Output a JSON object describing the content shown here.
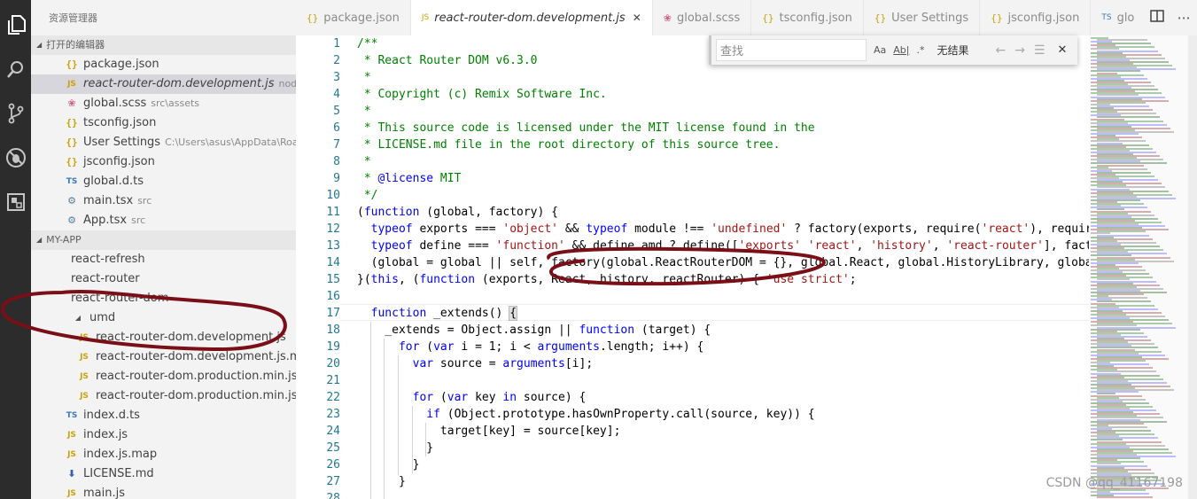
{
  "activity_bar": {
    "icons": [
      "explorer-icon",
      "search-icon",
      "source-control-icon",
      "debug-icon",
      "extensions-icon"
    ]
  },
  "sidebar": {
    "title": "资源管理器",
    "open_editors": {
      "label": "打开的编辑器",
      "items": [
        {
          "icon": "{}",
          "name": "package.json",
          "desc": "",
          "kind": "json",
          "active": false
        },
        {
          "icon": "JS",
          "name": "react-router-dom.development.js",
          "desc": "node_mo...",
          "kind": "js",
          "active": true
        },
        {
          "icon": "scss",
          "name": "global.scss",
          "desc": "src\\assets",
          "kind": "scss",
          "active": false
        },
        {
          "icon": "{}",
          "name": "tsconfig.json",
          "desc": "",
          "kind": "json",
          "active": false
        },
        {
          "icon": "{}",
          "name": "User Settings",
          "desc": "C:\\Users\\asus\\AppData\\Roam...",
          "kind": "json",
          "active": false
        },
        {
          "icon": "{}",
          "name": "jsconfig.json",
          "desc": "",
          "kind": "json",
          "active": false
        },
        {
          "icon": "TS",
          "name": "global.d.ts",
          "desc": "",
          "kind": "ts",
          "active": false
        },
        {
          "icon": "gear",
          "name": "main.tsx",
          "desc": "src",
          "kind": "gear",
          "active": false
        },
        {
          "icon": "gear",
          "name": "App.tsx",
          "desc": "src",
          "kind": "gear",
          "active": false
        }
      ]
    },
    "project": {
      "label": "MY-APP",
      "items": [
        {
          "icon": "",
          "name": "react-refresh",
          "indent": 45,
          "kind": "folder"
        },
        {
          "icon": "",
          "name": "react-router",
          "indent": 45,
          "kind": "folder"
        },
        {
          "icon": "",
          "name": "react-router-dom",
          "indent": 45,
          "kind": "folder"
        },
        {
          "icon": "▴",
          "name": "umd",
          "indent": 45,
          "kind": "folder-open"
        },
        {
          "icon": "JS",
          "name": "react-router-dom.development.js",
          "indent": 52,
          "kind": "js"
        },
        {
          "icon": "JS",
          "name": "react-router-dom.development.js.map",
          "indent": 52,
          "kind": "js"
        },
        {
          "icon": "JS",
          "name": "react-router-dom.production.min.js",
          "indent": 52,
          "kind": "js"
        },
        {
          "icon": "JS",
          "name": "react-router-dom.production.min.js.m...",
          "indent": 52,
          "kind": "js"
        },
        {
          "icon": "TS",
          "name": "index.d.ts",
          "indent": 38,
          "kind": "ts"
        },
        {
          "icon": "JS",
          "name": "index.js",
          "indent": 38,
          "kind": "js"
        },
        {
          "icon": "JS",
          "name": "index.js.map",
          "indent": 38,
          "kind": "js"
        },
        {
          "icon": "⬇",
          "name": "LICENSE.md",
          "indent": 38,
          "kind": "dl"
        },
        {
          "icon": "JS",
          "name": "main.js",
          "indent": 38,
          "kind": "js"
        }
      ]
    }
  },
  "tabs": [
    {
      "icon": "{}",
      "name": "package.json",
      "kind": "json",
      "active": false
    },
    {
      "icon": "JS",
      "name": "react-router-dom.development.js",
      "kind": "js",
      "active": true,
      "close": "✕"
    },
    {
      "icon": "scss",
      "name": "global.scss",
      "kind": "scss",
      "active": false
    },
    {
      "icon": "{}",
      "name": "tsconfig.json",
      "kind": "json",
      "active": false
    },
    {
      "icon": "{}",
      "name": "User Settings",
      "kind": "json",
      "active": false
    },
    {
      "icon": "{}",
      "name": "jsconfig.json",
      "kind": "json",
      "active": false
    },
    {
      "icon": "TS",
      "name": "glo",
      "kind": "ts",
      "active": false
    }
  ],
  "tab_actions": [
    "split-editor-icon",
    "more-icon"
  ],
  "find_widget": {
    "placeholder": "查找",
    "match_case": "Aa",
    "whole_word": "Ab|",
    "regex": ".*",
    "result": "无结果",
    "prev": "←",
    "next": "→",
    "selection": "☰",
    "close": "✕"
  },
  "editor": {
    "line_numbers": [
      1,
      2,
      3,
      4,
      5,
      6,
      7,
      8,
      9,
      10,
      11,
      12,
      13,
      14,
      15,
      16,
      17,
      18,
      19,
      20,
      21,
      22,
      23,
      24,
      25,
      26,
      27,
      28
    ],
    "lines": [
      [
        [
          "c-com",
          "/**"
        ]
      ],
      [
        [
          "c-com",
          " * React Router DOM v6.3.0"
        ]
      ],
      [
        [
          "c-com",
          " *"
        ]
      ],
      [
        [
          "c-com",
          " * Copyright (c) Remix Software Inc."
        ]
      ],
      [
        [
          "c-com",
          " *"
        ]
      ],
      [
        [
          "c-com",
          " * This source code is licensed under the MIT license found in the"
        ]
      ],
      [
        [
          "c-com",
          " * LICENSE.md file in the root directory of this source tree."
        ]
      ],
      [
        [
          "c-com",
          " *"
        ]
      ],
      [
        [
          "c-com",
          " * "
        ],
        [
          "c-ann",
          "@license"
        ],
        [
          "c-com",
          " MIT"
        ]
      ],
      [
        [
          "c-com",
          " */"
        ]
      ],
      [
        [
          "",
          "("
        ],
        [
          "c-kw",
          "function"
        ],
        [
          "",
          " (global, factory) {"
        ]
      ],
      [
        [
          "",
          "  "
        ],
        [
          "c-kw",
          "typeof"
        ],
        [
          "",
          " exports === "
        ],
        [
          "c-str",
          "'object'"
        ],
        [
          "",
          " && "
        ],
        [
          "c-kw",
          "typeof"
        ],
        [
          "",
          " module !== "
        ],
        [
          "c-str",
          "'undefined'"
        ],
        [
          "",
          " ? factory(exports, require("
        ],
        [
          "c-str",
          "'react'"
        ],
        [
          "",
          "), require("
        ]
      ],
      [
        [
          "",
          "  "
        ],
        [
          "c-kw",
          "typeof"
        ],
        [
          "",
          " define === "
        ],
        [
          "c-str",
          "'function'"
        ],
        [
          "",
          " && define.amd ? define(["
        ],
        [
          "c-str",
          "'exports'"
        ],
        [
          ",",
          ""
        ],
        [
          "",
          " "
        ],
        [
          "c-str",
          "'react'"
        ],
        [
          "",
          ", "
        ],
        [
          "c-str",
          "'history'"
        ],
        [
          "",
          ", "
        ],
        [
          "c-str",
          "'react-router'"
        ],
        [
          "",
          "], facto"
        ]
      ],
      [
        [
          "",
          "  (global = global || self, factory(global.ReactRouterDOM = {}, global.React, global.HistoryLibrary, global."
        ]
      ],
      [
        [
          "",
          "}("
        ],
        [
          "c-kw",
          "this"
        ],
        [
          "",
          ", ("
        ],
        [
          "c-kw",
          "function"
        ],
        [
          "",
          " (exports, React, history, reactRouter) { "
        ],
        [
          "c-str",
          "'use strict'"
        ],
        [
          "",
          ";"
        ]
      ],
      [
        [
          "",
          ""
        ]
      ],
      [
        [
          "",
          "  "
        ],
        [
          "c-kw",
          "function"
        ],
        [
          "",
          " _extends() "
        ],
        [
          "c-hl",
          "{"
        ]
      ],
      [
        [
          "",
          "    _extends = Object.assign || "
        ],
        [
          "c-kw",
          "function"
        ],
        [
          "",
          " (target) {"
        ]
      ],
      [
        [
          "",
          "      "
        ],
        [
          "c-kw",
          "for"
        ],
        [
          "",
          " ("
        ],
        [
          "c-kw",
          "var"
        ],
        [
          "",
          " i = 1; i < "
        ],
        [
          "c-kw",
          "arguments"
        ],
        [
          "",
          ".length; i++) {"
        ]
      ],
      [
        [
          "",
          "        "
        ],
        [
          "c-kw",
          "var"
        ],
        [
          "",
          " source = "
        ],
        [
          "c-kw",
          "arguments"
        ],
        [
          "",
          "[i];"
        ]
      ],
      [
        [
          "",
          ""
        ]
      ],
      [
        [
          "",
          "        "
        ],
        [
          "c-kw",
          "for"
        ],
        [
          "",
          " ("
        ],
        [
          "c-kw",
          "var"
        ],
        [
          "",
          " key "
        ],
        [
          "c-kw",
          "in"
        ],
        [
          "",
          " source) {"
        ]
      ],
      [
        [
          "",
          "          "
        ],
        [
          "c-kw",
          "if"
        ],
        [
          "",
          " (Object.prototype.hasOwnProperty.call(source, key)) {"
        ]
      ],
      [
        [
          "",
          "            target[key] = source[key];"
        ]
      ],
      [
        [
          "",
          "          }"
        ]
      ],
      [
        [
          "",
          "        }"
        ]
      ],
      [
        [
          "",
          "      }"
        ]
      ],
      [
        [
          "",
          ""
        ]
      ]
    ]
  },
  "watermark": "CSDN @qq_41167198",
  "colors": {
    "activity_bar": "#2c2c2c",
    "sidebar": "#f3f3f3",
    "annotation": "#7a0f17",
    "comment": "#008000",
    "keyword": "#0000ff",
    "string": "#a31515"
  }
}
